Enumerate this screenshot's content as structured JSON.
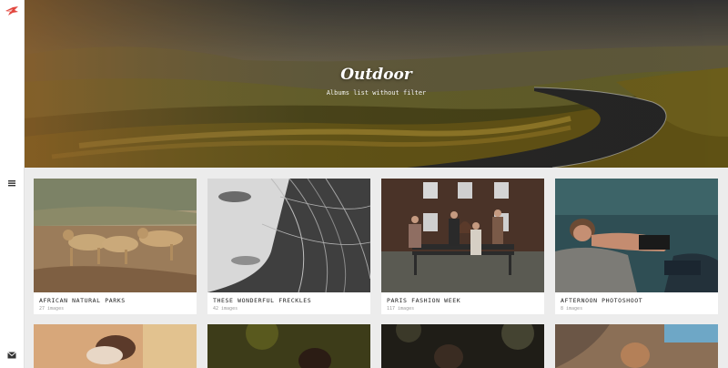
{
  "hero": {
    "title": "Outdoor",
    "subtitle": "Albums list without filter"
  },
  "icons": {
    "logo": "bird-logo-icon",
    "menu": "hamburger-menu-icon",
    "mail": "envelope-icon"
  },
  "colors": {
    "accent": "#e2473f",
    "card_bg": "#ffffff",
    "page_bg": "#ececec"
  },
  "albums": [
    {
      "title": "AFRICAN NATURAL PARKS",
      "count": "27 images"
    },
    {
      "title": "THESE WONDERFUL FRECKLES",
      "count": "42 images"
    },
    {
      "title": "PARIS FASHION WEEK",
      "count": "117 images"
    },
    {
      "title": "AFTERNOON PHOTOSHOOT",
      "count": "8 images"
    }
  ]
}
